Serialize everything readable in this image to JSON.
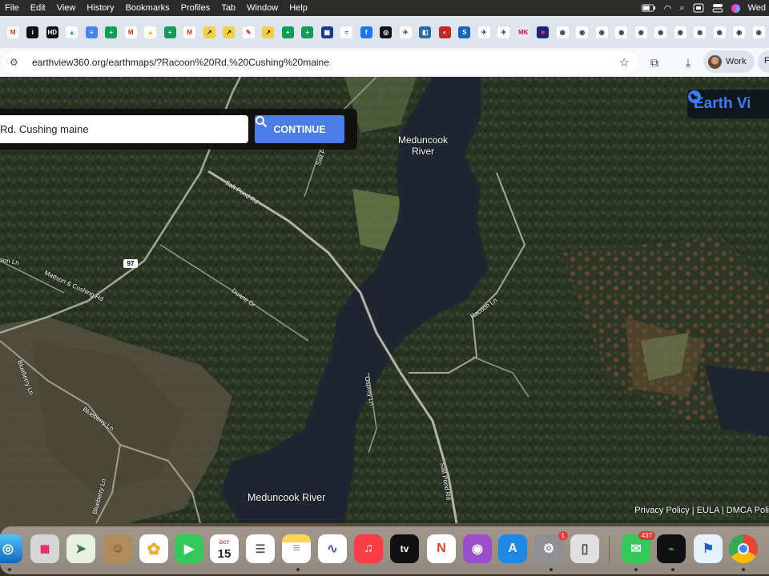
{
  "menubar": {
    "items": [
      "File",
      "Edit",
      "View",
      "History",
      "Bookmarks",
      "Profiles",
      "Tab",
      "Window",
      "Help"
    ],
    "clock": "Wed"
  },
  "tabs": [
    {
      "label": "M",
      "color": "#ffffff",
      "fg": "#d93025"
    },
    {
      "label": "i",
      "color": "#111111",
      "fg": "#ffffff"
    },
    {
      "label": "HD",
      "color": "#111111",
      "fg": "#ffffff"
    },
    {
      "label": "▲",
      "color": "#ffffff",
      "fg": "#1fa463"
    },
    {
      "label": "≡",
      "color": "#4285f4",
      "fg": "#ffffff"
    },
    {
      "label": "+",
      "color": "#0f9d58",
      "fg": "#ffffff"
    },
    {
      "label": "M",
      "color": "#ffffff",
      "fg": "#d93025"
    },
    {
      "label": "▲",
      "color": "#ffffff",
      "fg": "#f4b400"
    },
    {
      "label": "+",
      "color": "#0f9d58",
      "fg": "#ffffff"
    },
    {
      "label": "M",
      "color": "#ffffff",
      "fg": "#d93025"
    },
    {
      "label": "↗",
      "color": "#f4d03f",
      "fg": "#111111"
    },
    {
      "label": "↗",
      "color": "#f4d03f",
      "fg": "#111111"
    },
    {
      "label": "✎",
      "color": "#ffffff",
      "fg": "#c0392b"
    },
    {
      "label": "↗",
      "color": "#f4d03f",
      "fg": "#111111"
    },
    {
      "label": "+",
      "color": "#0f9d58",
      "fg": "#ffffff"
    },
    {
      "label": "+",
      "color": "#0f9d58",
      "fg": "#ffffff"
    },
    {
      "label": "▦",
      "color": "#1a3a8a",
      "fg": "#ffffff"
    },
    {
      "label": "≈",
      "color": "#ffffff",
      "fg": "#2255aa"
    },
    {
      "label": "f",
      "color": "#1877f2",
      "fg": "#ffffff"
    },
    {
      "label": "◎",
      "color": "#111111",
      "fg": "#ffffff"
    },
    {
      "label": "✈",
      "color": "#ffffff",
      "fg": "#333333"
    },
    {
      "label": "◧",
      "color": "#2c6aa0",
      "fg": "#ffffff"
    },
    {
      "label": "◐",
      "color": "#c62828",
      "fg": "#ffffff"
    },
    {
      "label": "S",
      "color": "#1565c0",
      "fg": "#ffffff"
    },
    {
      "label": "✈",
      "color": "#ffffff",
      "fg": "#333333"
    },
    {
      "label": "✈",
      "color": "#ffffff",
      "fg": "#333333"
    },
    {
      "label": "MK",
      "color": "#f3e5f5",
      "fg": "#c2185b"
    },
    {
      "label": "■",
      "color": "#1a237e",
      "fg": "#e53935"
    },
    {
      "label": "◉",
      "color": "#ffffff",
      "fg": "#444444"
    },
    {
      "label": "◉",
      "color": "#ffffff",
      "fg": "#444444"
    },
    {
      "label": "◉",
      "color": "#ffffff",
      "fg": "#444444"
    },
    {
      "label": "◉",
      "color": "#ffffff",
      "fg": "#444444"
    },
    {
      "label": "◉",
      "color": "#ffffff",
      "fg": "#444444"
    },
    {
      "label": "◉",
      "color": "#ffffff",
      "fg": "#444444"
    },
    {
      "label": "◉",
      "color": "#ffffff",
      "fg": "#444444"
    },
    {
      "label": "◉",
      "color": "#ffffff",
      "fg": "#444444"
    },
    {
      "label": "◉",
      "color": "#ffffff",
      "fg": "#444444"
    },
    {
      "label": "◉",
      "color": "#ffffff",
      "fg": "#444444"
    },
    {
      "label": "◉",
      "color": "#ffffff",
      "fg": "#444444"
    }
  ],
  "address": {
    "url": "earthview360.org/earthmaps/?Racoon%20Rd.%20Cushing%20maine",
    "profile_name": "Work",
    "profile2": "F"
  },
  "search": {
    "value": "Rd. Cushing maine",
    "button_label": "CONTINUE"
  },
  "logo": {
    "text": "Earth Vi"
  },
  "map_labels": {
    "river_top_1": "Meduncook",
    "river_top_2": "River",
    "river_bottom": "Meduncook River",
    "salt_pond_rd_1": "Salt Pond Rd",
    "salt_pond_rd_2": "Salt Pond Rd",
    "salt_pond_rd_3": "Salt Pond Rd",
    "duane_dr": "Duane Dr",
    "mattson_cushing": "Mattson & Cushing Rd",
    "on_ln": "son Ln",
    "route": "97",
    "blueberry_1": "Blueberry Ln",
    "blueberry_2": "Blueberry Ln",
    "blueberry_3": "Blueberry Ln",
    "osprey_ln": "Osprey Ln",
    "racoon_ln": "Racoon Ln"
  },
  "footer": "Privacy Policy | EULA | DMCA Poli",
  "dock": {
    "calendar_month": "OCT",
    "calendar_day": "15",
    "settings_badge": "1",
    "messages_badge": "437",
    "appletv_label": "tv"
  }
}
